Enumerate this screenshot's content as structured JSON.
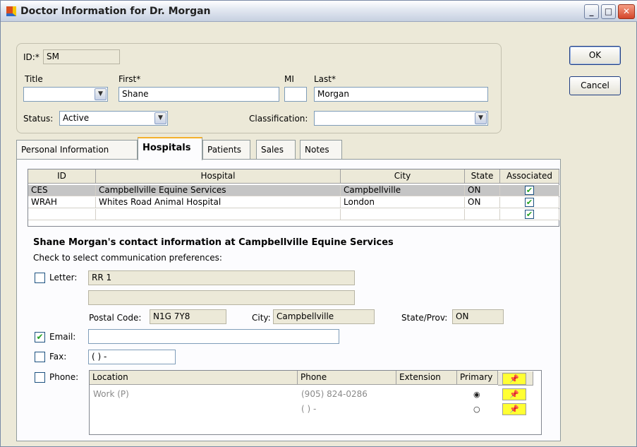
{
  "window": {
    "title": "Doctor Information for Dr. Morgan",
    "controls": {
      "minimize": "_",
      "maximize": "□",
      "close": "✕"
    }
  },
  "header": {
    "id_label": "ID:*",
    "id_value": "SM",
    "title_label": "Title",
    "title_value": "",
    "first_label": "First*",
    "first_value": "Shane",
    "mi_label": "MI",
    "mi_value": "",
    "last_label": "Last*",
    "last_value": "Morgan",
    "status_label": "Status:",
    "status_value": "Active",
    "classification_label": "Classification:",
    "classification_value": ""
  },
  "buttons": {
    "ok": "OK",
    "cancel": "Cancel"
  },
  "tabs": [
    {
      "label": "Personal Information",
      "active": false
    },
    {
      "label": "Hospitals",
      "active": true
    },
    {
      "label": "Patients",
      "active": false
    },
    {
      "label": "Sales",
      "active": false
    },
    {
      "label": "Notes",
      "active": false
    }
  ],
  "hospitals_table": {
    "columns": [
      "ID",
      "Hospital",
      "City",
      "State",
      "Associated"
    ],
    "rows": [
      {
        "id": "CES",
        "hospital": "Campbellville Equine Services",
        "city": "Campbellville",
        "state": "ON",
        "associated": true,
        "selected": true
      },
      {
        "id": "WRAH",
        "hospital": "Whites Road Animal Hospital",
        "city": "London",
        "state": "ON",
        "associated": true,
        "selected": false
      },
      {
        "id": "",
        "hospital": "",
        "city": "",
        "state": "",
        "associated": true,
        "selected": false
      }
    ]
  },
  "contact": {
    "heading": "Shane Morgan's contact information at Campbellville Equine Services",
    "instructions": "Check to select communication preferences:",
    "letter_label": "Letter:",
    "letter_checked": false,
    "address_line1": "RR 1",
    "address_line2": "",
    "postal_label": "Postal Code:",
    "postal_value": "N1G 7Y8",
    "city_label": "City:",
    "city_value": "Campbellville",
    "state_label": "State/Prov:",
    "state_value": "ON",
    "email_label": "Email:",
    "email_checked": true,
    "email_value": "",
    "fax_label": "Fax:",
    "fax_checked": false,
    "fax_value": "( )  -",
    "phone_label": "Phone:",
    "phone_checked": false
  },
  "phone_table": {
    "columns": [
      "Location",
      "Phone",
      "Extension",
      "Primary"
    ],
    "rows": [
      {
        "location": "Work (P)",
        "phone": "(905) 824-0286",
        "extension": "",
        "primary": true
      },
      {
        "location": "",
        "phone": "( )  -",
        "extension": "",
        "primary": false
      }
    ]
  },
  "icons": {
    "checkbox_checked": "✔",
    "combo": "▼",
    "pin": "📌",
    "radio_on": "◉",
    "radio_off": "○"
  }
}
